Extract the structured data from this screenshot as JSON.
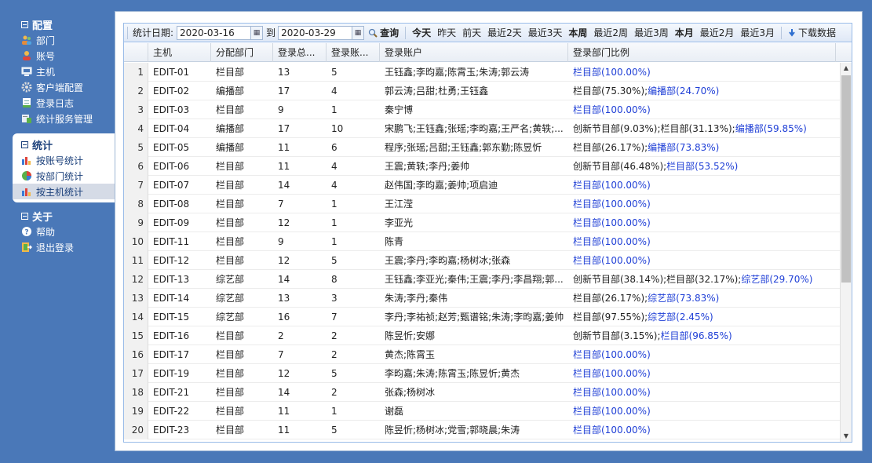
{
  "sidebar": {
    "config": {
      "title": "配置",
      "items": [
        {
          "label": "部门",
          "icon": "users-icon"
        },
        {
          "label": "账号",
          "icon": "user-icon"
        },
        {
          "label": "主机",
          "icon": "monitor-icon"
        },
        {
          "label": "客户端配置",
          "icon": "gear-icon"
        },
        {
          "label": "登录日志",
          "icon": "log-icon"
        },
        {
          "label": "统计服务管理",
          "icon": "server-icon"
        }
      ]
    },
    "stats": {
      "title": "统计",
      "items": [
        {
          "label": "按账号统计",
          "icon": "bar-chart-icon"
        },
        {
          "label": "按部门统计",
          "icon": "pie-chart-icon"
        },
        {
          "label": "按主机统计",
          "icon": "bar-chart-icon"
        }
      ]
    },
    "about": {
      "title": "关于",
      "items": [
        {
          "label": "帮助",
          "icon": "help-icon"
        },
        {
          "label": "退出登录",
          "icon": "exit-icon"
        }
      ]
    }
  },
  "toolbar": {
    "date_label": "统计日期:",
    "date_from": "2020-03-16",
    "to_label": "到",
    "date_to": "2020-03-29",
    "query": "查询",
    "quick": [
      "今天",
      "昨天",
      "前天",
      "最近2天",
      "最近3天",
      "本周",
      "最近2周",
      "最近3周",
      "本月",
      "最近2月",
      "最近3月"
    ],
    "download": "下载数据"
  },
  "grid": {
    "headers": [
      "主机",
      "分配部门",
      "登录总...",
      "登录账...",
      "登录账户",
      "登录部门比例"
    ],
    "rows": [
      {
        "n": "1",
        "host": "EDIT-01",
        "dept": "栏目部",
        "total": "13",
        "accounts": "5",
        "users": "王钰鑫;李昀嘉;陈霄玉;朱涛;郭云涛",
        "ratio_plain": "",
        "ratio_blue": "栏目部(100.00%)"
      },
      {
        "n": "2",
        "host": "EDIT-02",
        "dept": "编播部",
        "total": "17",
        "accounts": "4",
        "users": "郭云涛;吕甜;杜勇;王钰鑫",
        "ratio_plain": "栏目部(75.30%);",
        "ratio_blue": "编播部(24.70%)"
      },
      {
        "n": "3",
        "host": "EDIT-03",
        "dept": "栏目部",
        "total": "9",
        "accounts": "1",
        "users": "秦宁博",
        "ratio_plain": "",
        "ratio_blue": "栏目部(100.00%)"
      },
      {
        "n": "4",
        "host": "EDIT-04",
        "dept": "编播部",
        "total": "17",
        "accounts": "10",
        "users": "宋鹏飞;王钰鑫;张瑶;李昀嘉;王严名;黄轶;...",
        "ratio_plain": "创新节目部(9.03%);栏目部(31.13%);",
        "ratio_blue": "编播部(59.85%)"
      },
      {
        "n": "5",
        "host": "EDIT-05",
        "dept": "编播部",
        "total": "11",
        "accounts": "6",
        "users": "程序;张瑶;吕甜;王钰鑫;郭东勤;陈昱忻",
        "ratio_plain": "栏目部(26.17%);",
        "ratio_blue": "编播部(73.83%)"
      },
      {
        "n": "6",
        "host": "EDIT-06",
        "dept": "栏目部",
        "total": "11",
        "accounts": "4",
        "users": "王震;黄轶;李丹;姜帅",
        "ratio_plain": "创新节目部(46.48%);",
        "ratio_blue": "栏目部(53.52%)"
      },
      {
        "n": "7",
        "host": "EDIT-07",
        "dept": "栏目部",
        "total": "14",
        "accounts": "4",
        "users": "赵伟国;李昀嘉;姜帅;项启迪",
        "ratio_plain": "",
        "ratio_blue": "栏目部(100.00%)"
      },
      {
        "n": "8",
        "host": "EDIT-08",
        "dept": "栏目部",
        "total": "7",
        "accounts": "1",
        "users": "王江滢",
        "ratio_plain": "",
        "ratio_blue": "栏目部(100.00%)"
      },
      {
        "n": "9",
        "host": "EDIT-09",
        "dept": "栏目部",
        "total": "12",
        "accounts": "1",
        "users": "李亚光",
        "ratio_plain": "",
        "ratio_blue": "栏目部(100.00%)"
      },
      {
        "n": "10",
        "host": "EDIT-11",
        "dept": "栏目部",
        "total": "9",
        "accounts": "1",
        "users": "陈青",
        "ratio_plain": "",
        "ratio_blue": "栏目部(100.00%)"
      },
      {
        "n": "11",
        "host": "EDIT-12",
        "dept": "栏目部",
        "total": "12",
        "accounts": "5",
        "users": "王震;李丹;李昀嘉;杨树冰;张森",
        "ratio_plain": "",
        "ratio_blue": "栏目部(100.00%)"
      },
      {
        "n": "12",
        "host": "EDIT-13",
        "dept": "综艺部",
        "total": "14",
        "accounts": "8",
        "users": "王钰鑫;李亚光;秦伟;王震;李丹;李昌翔;郭...",
        "ratio_plain": "创新节目部(38.14%);栏目部(32.17%);",
        "ratio_blue": "综艺部(29.70%)"
      },
      {
        "n": "13",
        "host": "EDIT-14",
        "dept": "综艺部",
        "total": "13",
        "accounts": "3",
        "users": "朱涛;李丹;秦伟",
        "ratio_plain": "栏目部(26.17%);",
        "ratio_blue": "综艺部(73.83%)"
      },
      {
        "n": "14",
        "host": "EDIT-15",
        "dept": "综艺部",
        "total": "16",
        "accounts": "7",
        "users": "李丹;李祐祯;赵芳;甄谱铭;朱涛;李昀嘉;姜帅",
        "ratio_plain": "栏目部(97.55%);",
        "ratio_blue": "综艺部(2.45%)"
      },
      {
        "n": "15",
        "host": "EDIT-16",
        "dept": "栏目部",
        "total": "2",
        "accounts": "2",
        "users": "陈昱忻;安娜",
        "ratio_plain": "创新节目部(3.15%);",
        "ratio_blue": "栏目部(96.85%)"
      },
      {
        "n": "16",
        "host": "EDIT-17",
        "dept": "栏目部",
        "total": "7",
        "accounts": "2",
        "users": "黄杰;陈霄玉",
        "ratio_plain": "",
        "ratio_blue": "栏目部(100.00%)"
      },
      {
        "n": "17",
        "host": "EDIT-19",
        "dept": "栏目部",
        "total": "12",
        "accounts": "5",
        "users": "李昀嘉;朱涛;陈霄玉;陈昱忻;黄杰",
        "ratio_plain": "",
        "ratio_blue": "栏目部(100.00%)"
      },
      {
        "n": "18",
        "host": "EDIT-21",
        "dept": "栏目部",
        "total": "14",
        "accounts": "2",
        "users": "张森;杨树冰",
        "ratio_plain": "",
        "ratio_blue": "栏目部(100.00%)"
      },
      {
        "n": "19",
        "host": "EDIT-22",
        "dept": "栏目部",
        "total": "11",
        "accounts": "1",
        "users": "谢磊",
        "ratio_plain": "",
        "ratio_blue": "栏目部(100.00%)"
      },
      {
        "n": "20",
        "host": "EDIT-23",
        "dept": "栏目部",
        "total": "11",
        "accounts": "5",
        "users": "陈昱忻;杨树冰;党雪;郭晓晨;朱涛",
        "ratio_plain": "",
        "ratio_blue": "栏目部(100.00%)"
      }
    ]
  },
  "colors": {
    "background": "#4a78b8",
    "link_blue": "#1f3fd6",
    "active_bg": "#ffffff"
  }
}
